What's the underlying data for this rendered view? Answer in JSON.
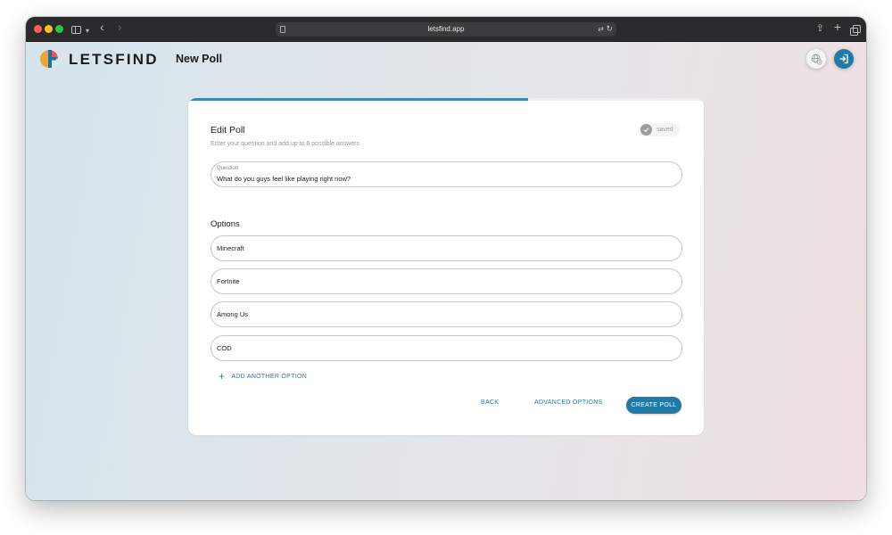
{
  "browser": {
    "url": "letsfind.app"
  },
  "header": {
    "brand": "LETSFIND",
    "page_title": "New Poll"
  },
  "card": {
    "progress_fraction": 0.66,
    "title": "Edit Poll",
    "subtitle": "Enter your question and add up to 6 possible answers",
    "saved_label": "saved",
    "question": {
      "label": "Question",
      "value": "What do you guys feel like playing right now?"
    },
    "options_heading": "Options",
    "options": [
      "Minecraft",
      "Fortnite",
      "Among Us",
      "COD"
    ],
    "add_option_label": "ADD ANOTHER OPTION",
    "back_label": "BACK",
    "advanced_label": "ADVANCED OPTIONS",
    "create_label": "CREATE POLL"
  },
  "colors": {
    "accent": "#1f7ba5",
    "progress": "#3d8ab5"
  },
  "icons": {
    "logo": "letsfind-logo",
    "language": "globe-icon",
    "login": "login-icon",
    "saved": "check-icon",
    "add": "plus-icon"
  }
}
